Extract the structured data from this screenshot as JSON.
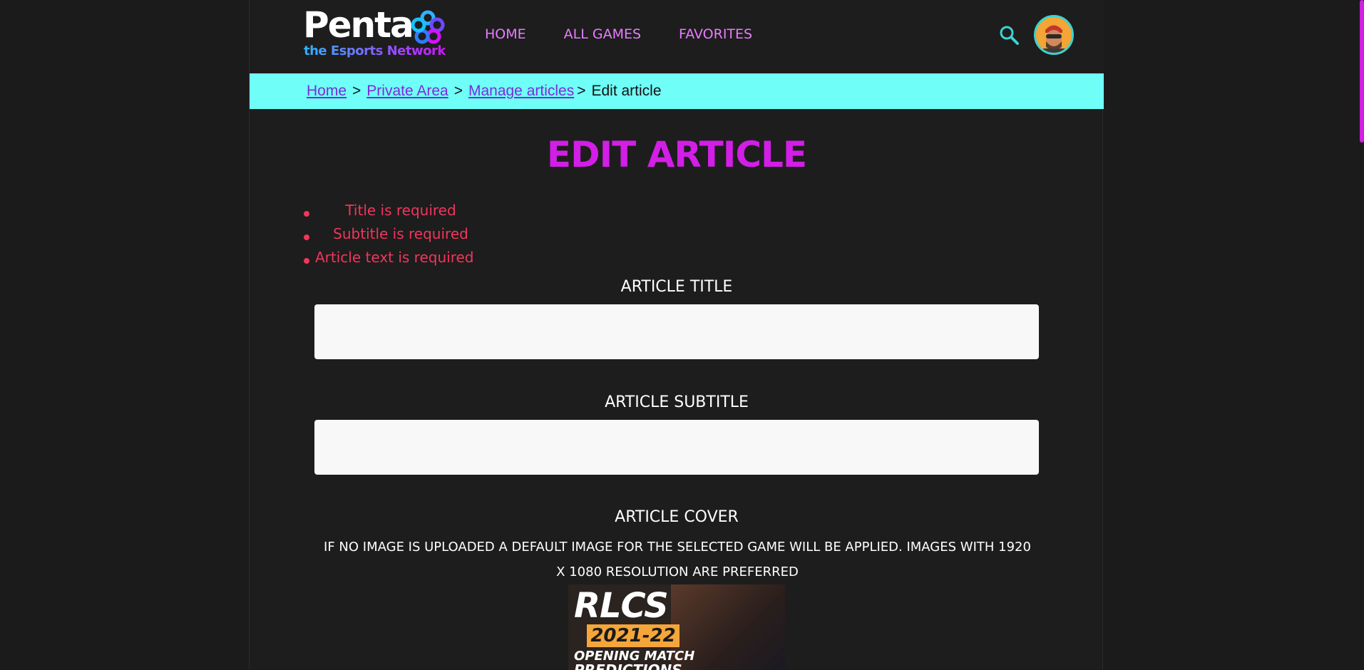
{
  "brand": {
    "name": "Penta",
    "tagline": "the Esports Network"
  },
  "nav": {
    "items": [
      "HOME",
      "ALL GAMES",
      "FAVORITES"
    ]
  },
  "breadcrumb": {
    "items": [
      "Home",
      "Private Area",
      "Manage articles "
    ],
    "separator": ">",
    "current": "Edit article"
  },
  "page": {
    "title": "EDIT ARTICLE"
  },
  "errors": [
    "Title is required",
    "Subtitle is required",
    "Article text is required"
  ],
  "form": {
    "title_label": "ARTICLE TITLE",
    "title_value": "",
    "subtitle_label": "ARTICLE SUBTITLE",
    "subtitle_value": "",
    "cover_label": "ARTICLE COVER",
    "cover_note": "IF NO IMAGE IS UPLOADED A DEFAULT IMAGE FOR THE SELECTED GAME WILL BE APPLIED. IMAGES WITH 1920 X 1080 RESOLUTION ARE PREFERRED"
  },
  "cover_image": {
    "line1": "RLCS",
    "line2": "2021-22",
    "line3": "OPENING MATCH",
    "line4": "PREDICTIONS"
  },
  "colors": {
    "accent": "#d21ee6",
    "nav_link": "#e87cff",
    "breadcrumb_bg": "#6ffff8",
    "error": "#f2355c",
    "icon": "#3bd3d3"
  },
  "icons": {
    "search": "search-icon",
    "avatar": "avatar"
  }
}
